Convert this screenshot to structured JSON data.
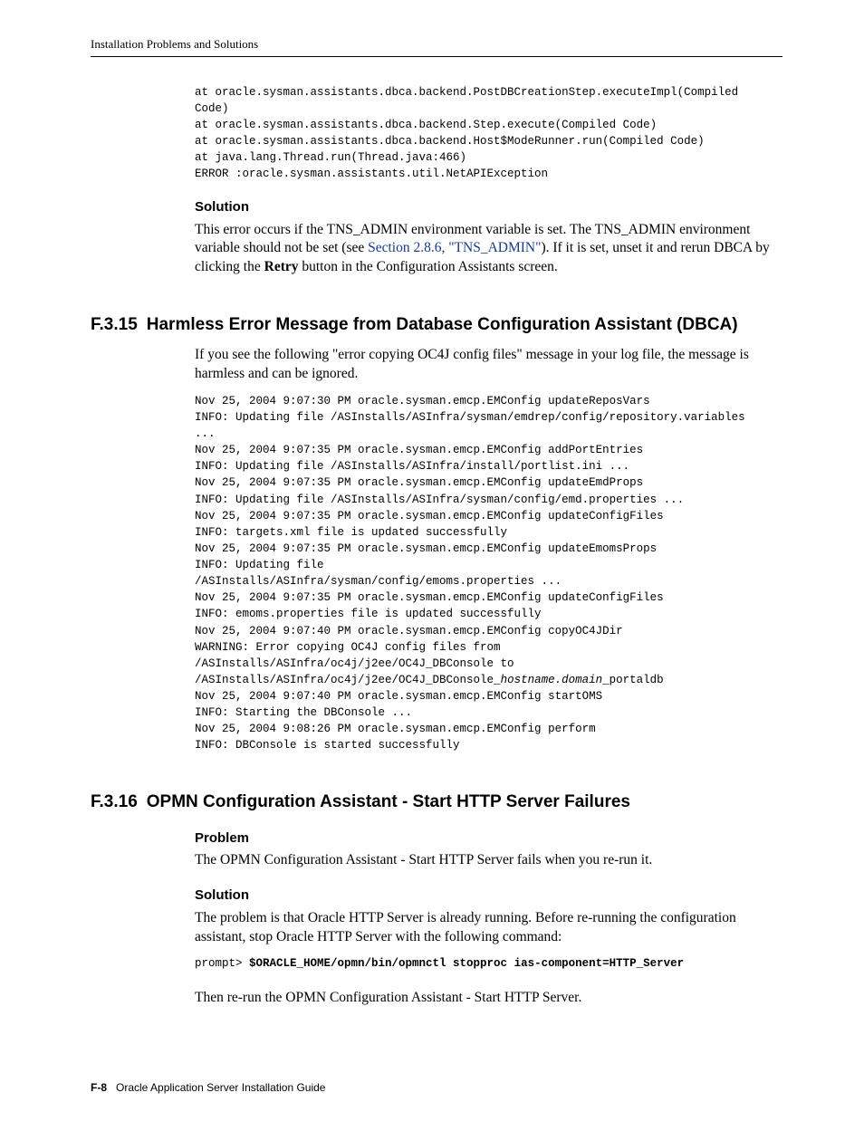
{
  "header": "Installation Problems and Solutions",
  "codeBlock1": "at oracle.sysman.assistants.dbca.backend.PostDBCreationStep.executeImpl(Compiled\nCode)\nat oracle.sysman.assistants.dbca.backend.Step.execute(Compiled Code)\nat oracle.sysman.assistants.dbca.backend.Host$ModeRunner.run(Compiled Code)\nat java.lang.Thread.run(Thread.java:466)\nERROR :oracle.sysman.assistants.util.NetAPIException",
  "solution1": {
    "heading": "Solution",
    "pre": "This error occurs if the TNS_ADMIN environment variable is set. The TNS_ADMIN environment variable should not be set (see ",
    "link": "Section 2.8.6, \"TNS_ADMIN\"",
    "mid": "). If it is set, unset it and rerun DBCA by clicking the ",
    "retry": "Retry",
    "post": " button in the Configuration Assistants screen."
  },
  "sec15": {
    "num": "F.3.15",
    "title": "Harmless Error Message from Database Configuration Assistant (DBCA)",
    "intro": "If you see the following \"error copying OC4J config files\" message in your log file, the message is harmless and can be ignored.",
    "log_a": "Nov 25, 2004 9:07:30 PM oracle.sysman.emcp.EMConfig updateReposVars\nINFO: Updating file /ASInstalls/ASInfra/sysman/emdrep/config/repository.variables\n...\nNov 25, 2004 9:07:35 PM oracle.sysman.emcp.EMConfig addPortEntries\nINFO: Updating file /ASInstalls/ASInfra/install/portlist.ini ...\nNov 25, 2004 9:07:35 PM oracle.sysman.emcp.EMConfig updateEmdProps\nINFO: Updating file /ASInstalls/ASInfra/sysman/config/emd.properties ...\nNov 25, 2004 9:07:35 PM oracle.sysman.emcp.EMConfig updateConfigFiles\nINFO: targets.xml file is updated successfully\nNov 25, 2004 9:07:35 PM oracle.sysman.emcp.EMConfig updateEmomsProps\nINFO: Updating file\n/ASInstalls/ASInfra/sysman/config/emoms.properties ...\nNov 25, 2004 9:07:35 PM oracle.sysman.emcp.EMConfig updateConfigFiles\nINFO: emoms.properties file is updated successfully\nNov 25, 2004 9:07:40 PM oracle.sysman.emcp.EMConfig copyOC4JDir\nWARNING: Error copying OC4J config files from\n/ASInstalls/ASInfra/oc4j/j2ee/OC4J_DBConsole to\n/ASInstalls/ASInfra/oc4j/j2ee/OC4J_DBConsole_",
    "log_italic": "hostname.domain",
    "log_b": "_portaldb\nNov 25, 2004 9:07:40 PM oracle.sysman.emcp.EMConfig startOMS\nINFO: Starting the DBConsole ...\nNov 25, 2004 9:08:26 PM oracle.sysman.emcp.EMConfig perform\nINFO: DBConsole is started successfully"
  },
  "sec16": {
    "num": "F.3.16",
    "title": "OPMN Configuration Assistant - Start HTTP Server Failures",
    "problemHeading": "Problem",
    "problemText": "The OPMN Configuration Assistant - Start HTTP Server fails when you re-run it.",
    "solutionHeading": "Solution",
    "solutionText": "The problem is that Oracle HTTP Server is already running. Before re-running the configuration assistant, stop Oracle HTTP Server with the following command:",
    "cmdPrompt": "prompt> ",
    "cmdBold": "$ORACLE_HOME/opmn/bin/opmnctl stopproc ias-component=HTTP_Server",
    "afterCmd": "Then re-run the OPMN Configuration Assistant - Start HTTP Server."
  },
  "footer": {
    "page": "F-8",
    "title": "Oracle Application Server Installation Guide"
  }
}
